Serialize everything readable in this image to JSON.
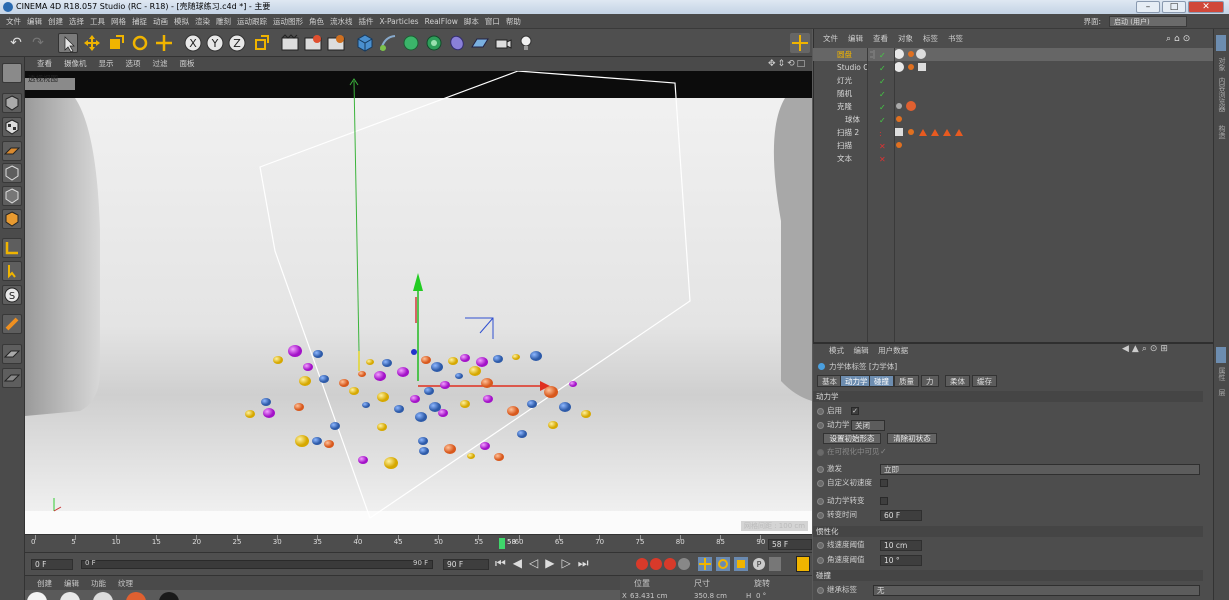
{
  "window": {
    "title": "CINEMA 4D R18.057 Studio (RC - R18) - [壳随球练习.c4d *] - 主要"
  },
  "menubar": {
    "items": [
      "文件",
      "编辑",
      "创建",
      "选择",
      "工具",
      "网格",
      "捕捉",
      "动画",
      "模拟",
      "渲染",
      "雕刻",
      "运动跟踪",
      "运动图形",
      "角色",
      "流水线",
      "插件",
      "X-Particles",
      "RealFlow",
      "脚本",
      "窗口",
      "帮助"
    ],
    "layout_label": "界面:",
    "layout_value": "启动 (用户)"
  },
  "viewport": {
    "menu": [
      "查看",
      "摄像机",
      "显示",
      "选项",
      "过滤",
      "面板"
    ],
    "name": "透视视图",
    "grid_label": "网格间距 : 100 cm"
  },
  "timeline": {
    "ticks": [
      "0",
      "5",
      "10",
      "15",
      "20",
      "25",
      "30",
      "35",
      "40",
      "45",
      "50",
      "55",
      "60",
      "65",
      "70",
      "75",
      "80",
      "85",
      "90"
    ],
    "current": "58",
    "end_field": "58 F"
  },
  "transport": {
    "start": "0 F",
    "range_start": "0 F",
    "range_end": "90 F",
    "end": "90 F"
  },
  "material_manager": {
    "menu": [
      "创建",
      "编辑",
      "功能",
      "纹理"
    ]
  },
  "coordinates": {
    "headers": [
      "位置",
      "尺寸",
      "旋转"
    ],
    "x_label": "X",
    "x_pos": "63.431 cm",
    "x_size": "350.8 cm",
    "h_label": "H",
    "h_rot": "0 °"
  },
  "object_manager": {
    "menu": [
      "文件",
      "编辑",
      "查看",
      "对象",
      "标签",
      "书签"
    ],
    "objects": [
      {
        "name": "圆盘",
        "selected": true
      },
      {
        "name": "Studio C"
      },
      {
        "name": "灯光"
      },
      {
        "name": "随机"
      },
      {
        "name": "克隆"
      },
      {
        "name": "球体"
      },
      {
        "name": "扫描 2"
      },
      {
        "name": "扫描"
      },
      {
        "name": "文本"
      }
    ]
  },
  "attribute_manager": {
    "menu": [
      "模式",
      "编辑",
      "用户数据"
    ],
    "title": "力学体标签 [力学体]",
    "tabs": [
      "基本",
      "动力学",
      "碰撞",
      "质量",
      "力",
      "柔体",
      "缓存"
    ],
    "active_tabs": [
      "动力学",
      "碰撞"
    ],
    "section_dynamics": "动力学",
    "enabled_label": "启用",
    "enabled_check": "✓",
    "dynamics_label": "动力学",
    "dynamics_value": "关闭",
    "set_initial_button": "设置初始形态",
    "clear_initial_button": "清除初状态",
    "visible_in_viewport_label": "在可视化中可见",
    "visible_in_viewport_check": "✓",
    "trigger_label": "激发",
    "trigger_value": "立即",
    "custom_velocity_label": "自定义初速度",
    "dynamic_transition_label": "动力学转变",
    "transition_time_label": "转变时间",
    "transition_time_value": "60 F",
    "section_inertia": "惯性化",
    "linear_threshold_label": "线速度阈值",
    "linear_threshold_value": "10 cm",
    "angular_threshold_label": "角速度阈值",
    "angular_threshold_value": "10 °",
    "section_collision": "碰撞",
    "inherit_tag_label": "继承标签",
    "inherit_tag_value": "无"
  },
  "right_strip": [
    "对象",
    "内容浏览器",
    "构造",
    "属性",
    "层"
  ],
  "colors": {
    "accent": "#6d8db0",
    "viewport_bg": "#c7c7c7",
    "timeline_marker": "#3fd66b"
  }
}
